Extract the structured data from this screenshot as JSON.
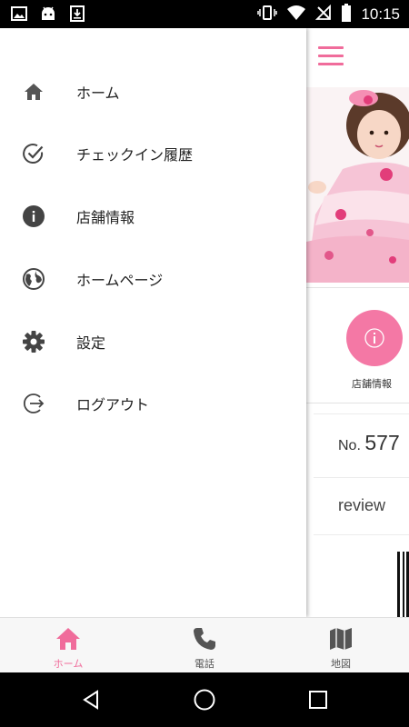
{
  "status_bar": {
    "time": "10:15",
    "left_icons": [
      "image-icon",
      "android-icon",
      "download-icon"
    ],
    "right_icons": [
      "vibrate-icon",
      "wifi-icon",
      "no-signal-icon",
      "battery-icon"
    ]
  },
  "drawer": {
    "items": [
      {
        "label": "ホーム",
        "icon": "home-icon"
      },
      {
        "label": "チェックイン履歴",
        "icon": "check-circle-icon"
      },
      {
        "label": "店舗情報",
        "icon": "info-icon"
      },
      {
        "label": "ホームページ",
        "icon": "globe-icon"
      },
      {
        "label": "設定",
        "icon": "gear-icon"
      },
      {
        "label": "ログアウト",
        "icon": "logout-icon"
      }
    ]
  },
  "main": {
    "info_button_label": "店舗情報",
    "number_prefix": "No.",
    "number_value": "577",
    "review_label": "review"
  },
  "tabbar": {
    "tabs": [
      {
        "label": "ホーム",
        "icon": "home-icon",
        "active": true
      },
      {
        "label": "電話",
        "icon": "phone-icon",
        "active": false
      },
      {
        "label": "地図",
        "icon": "map-icon",
        "active": false
      }
    ]
  },
  "colors": {
    "accent": "#f06c9b",
    "info_circle": "#f478a5",
    "icon_gray": "#555555"
  }
}
